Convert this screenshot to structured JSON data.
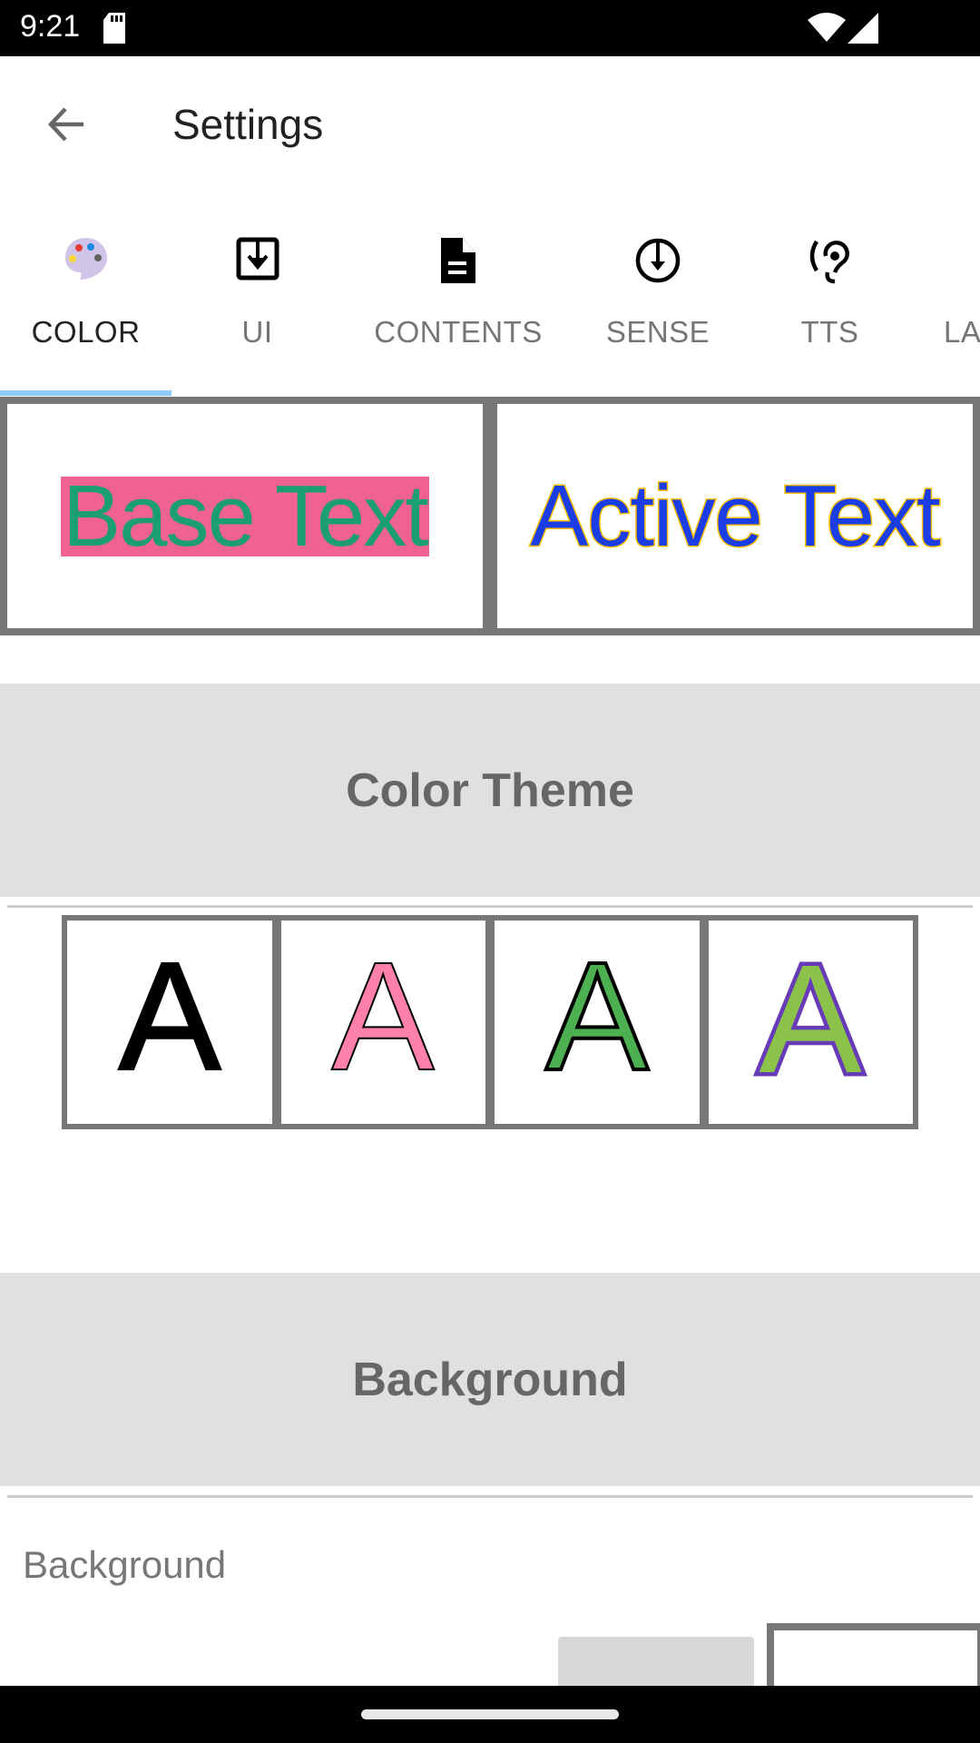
{
  "status_bar": {
    "time": "9:21",
    "icons": [
      "sd-card-icon",
      "wifi-icon",
      "signal-icon"
    ]
  },
  "app_bar": {
    "title": "Settings",
    "back_icon": "arrow-back-icon"
  },
  "tabs": [
    {
      "label": "COLOR",
      "icon": "palette-icon",
      "active": true
    },
    {
      "label": "UI",
      "icon": "download-box-icon"
    },
    {
      "label": "CONTENTS",
      "icon": "document-icon"
    },
    {
      "label": "SENSE",
      "icon": "circle-down-arrow-icon"
    },
    {
      "label": "TTS",
      "icon": "hearing-icon"
    },
    {
      "label": "LA",
      "icon": ""
    }
  ],
  "preview": {
    "base_text": "Base Text",
    "base_color": "#1a9e72",
    "base_highlight": "#f06292",
    "active_text": "Active Text",
    "active_color": "#1a3de6",
    "active_outline": "#ffc107"
  },
  "sections": {
    "color_theme": "Color Theme",
    "background": "Background"
  },
  "themes": [
    {
      "letter": "A",
      "fill": "#000000",
      "stroke": "#000000"
    },
    {
      "letter": "A",
      "fill": "#ff80ab",
      "stroke": "#000000"
    },
    {
      "letter": "A",
      "fill": "#4caf50",
      "stroke": "#000000"
    },
    {
      "letter": "A",
      "fill": "#8bc34a",
      "stroke": "#673ab7"
    }
  ],
  "background_label": "Background",
  "background_swatches": [
    "#d6d8d8",
    "#ffffff"
  ]
}
